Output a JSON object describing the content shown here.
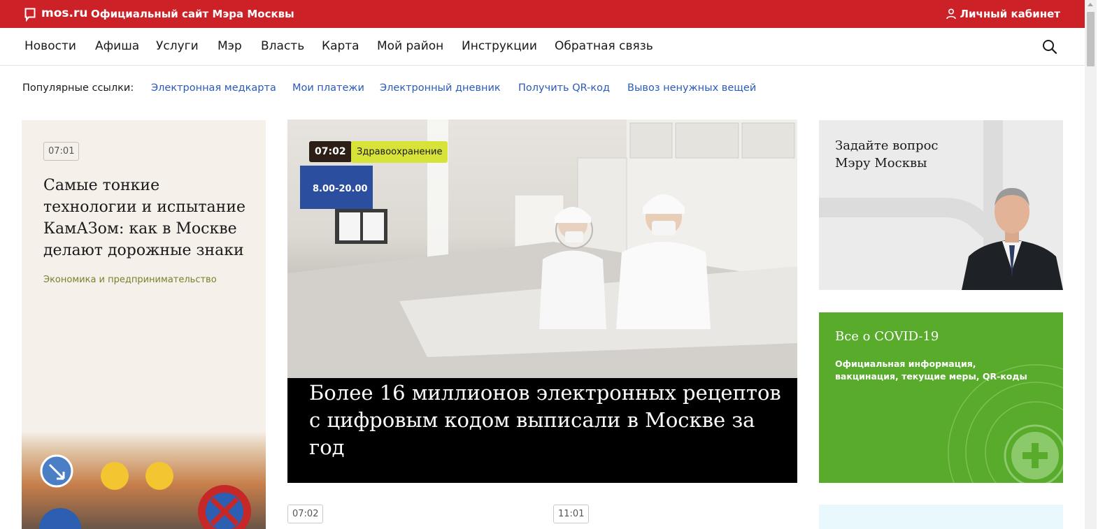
{
  "header": {
    "logo_text": "mos.ru",
    "site_title": "Официальный сайт Мэра Москвы",
    "cabinet_label": "Личный кабинет"
  },
  "nav": {
    "items": [
      "Новости",
      "Афиша",
      "Услуги",
      "Мэр",
      "Власть",
      "Карта",
      "Мой район",
      "Инструкции",
      "Обратная связь"
    ]
  },
  "popular": {
    "label": "Популярные ссылки:",
    "links": [
      "Электронная медкарта",
      "Мои платежи",
      "Электронный дневник",
      "Получить QR-код",
      "Вывоз ненужных вещей"
    ]
  },
  "left_card": {
    "time": "07:01",
    "title": "Самые тонкие технологии и испытание КамАЗом: как в Москве делают дорожные знаки",
    "category": "Экономика и предпринимательство"
  },
  "main_card": {
    "time": "07:02",
    "category": "Здравоохранение",
    "title": "Более 16 миллионов электронных рецептов с цифровым кодом выписали в Москве за год"
  },
  "mayor_card": {
    "title": "Задайте вопрос Мэру Москвы"
  },
  "covid_card": {
    "title": "Все о COVID-19",
    "description": "Официальная информация, вакцинация, текущие меры, QR-коды"
  },
  "bottom": {
    "time_1": "07:02",
    "time_2": "11:01"
  },
  "colors": {
    "brand_red": "#cc2127",
    "link_blue": "#2a5bb8",
    "covid_green": "#58ab2b",
    "category_badge": "#d7e339"
  }
}
